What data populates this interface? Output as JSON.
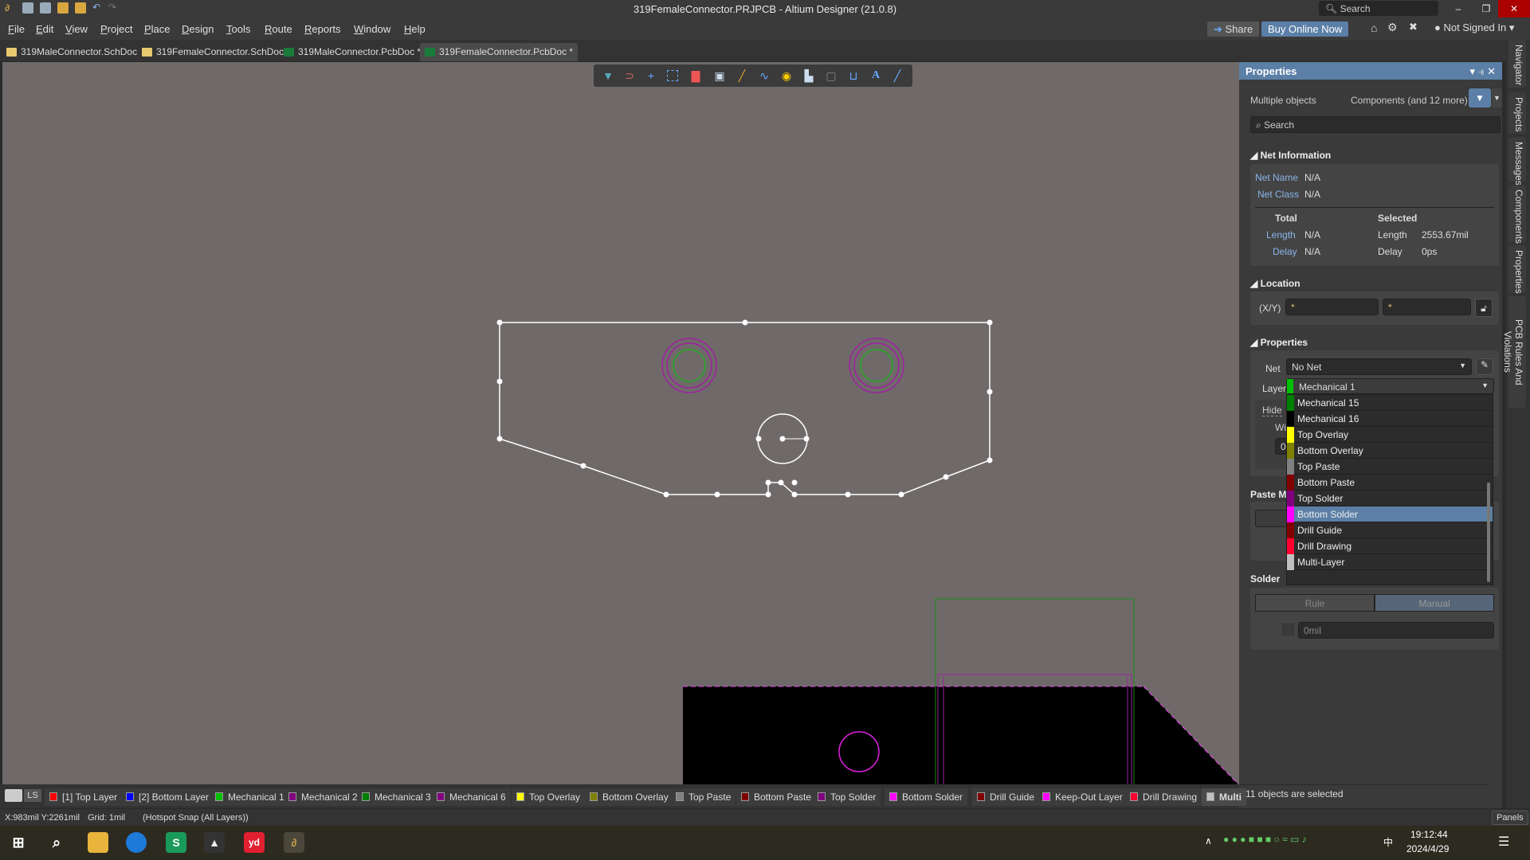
{
  "window": {
    "title": "319FemaleConnector.PRJPCB - Altium Designer (21.0.8)",
    "search_placeholder": "Search"
  },
  "menu": [
    "File",
    "Edit",
    "View",
    "Project",
    "Place",
    "Design",
    "Tools",
    "Route",
    "Reports",
    "Window",
    "Help"
  ],
  "header_buttons": {
    "share": "Share",
    "buy": "Buy Online Now",
    "account": "Not Signed In"
  },
  "tabs": [
    {
      "label": "319MaleConnector.SchDoc",
      "type": "sch"
    },
    {
      "label": "319FemaleConnector.SchDoc",
      "type": "sch"
    },
    {
      "label": "319MaleConnector.PcbDoc *",
      "type": "pcb"
    },
    {
      "label": "319FemaleConnector.PcbDoc *",
      "type": "pcb",
      "active": true
    }
  ],
  "toolbar_icons": [
    "filter-icon",
    "interactive-routing-icon",
    "crosshair-icon",
    "select-rect-icon",
    "align-icon",
    "component-icon",
    "route-icon",
    "length-tune-icon",
    "via-icon",
    "polygon-icon",
    "keepout-icon",
    "dimension-icon",
    "text-icon",
    "line-icon"
  ],
  "panel": {
    "title": "Properties",
    "selection": "Multiple objects",
    "filter": "Components (and 12 more)",
    "search_placeholder": "Search",
    "net_info": {
      "title": "Net Information",
      "net_name_label": "Net Name",
      "net_name": "N/A",
      "net_class_label": "Net Class",
      "net_class": "N/A",
      "total": "Total",
      "selected": "Selected",
      "length_label": "Length",
      "total_length": "N/A",
      "sel_length": "2553.67mil",
      "delay_label": "Delay",
      "total_delay": "N/A",
      "sel_delay": "0ps"
    },
    "location": {
      "title": "Location",
      "label": "(X/Y)",
      "x": "*",
      "y": "*"
    },
    "properties": {
      "title": "Properties",
      "net_label": "Net",
      "net": "No Net",
      "layer_label": "Layer",
      "layer": "Mechanical 1",
      "layer_color": "#00c000",
      "hide": "Hide",
      "width_label": "Wi",
      "width_val": "0"
    },
    "paste": {
      "title": "Paste M"
    },
    "solder": {
      "title": "Solder",
      "rule": "Rule",
      "manual": "Manual",
      "value": "0mil"
    },
    "layer_options": [
      {
        "label": "Mechanical 15",
        "color": "#008000"
      },
      {
        "label": "Mechanical 16",
        "color": "#000000"
      },
      {
        "label": "Top Overlay",
        "color": "#ffff00"
      },
      {
        "label": "Bottom Overlay",
        "color": "#808000"
      },
      {
        "label": "Top Paste",
        "color": "#808080"
      },
      {
        "label": "Bottom Paste",
        "color": "#800000"
      },
      {
        "label": "Top Solder",
        "color": "#800080"
      },
      {
        "label": "Bottom Solder",
        "color": "#ff00ff",
        "selected": true
      },
      {
        "label": "Drill Guide",
        "color": "#800000"
      },
      {
        "label": "Drill Drawing",
        "color": "#ff0030"
      },
      {
        "label": "Multi-Layer",
        "color": "#c0c0c0"
      }
    ],
    "footer": "11 objects are selected"
  },
  "right_tabs": [
    "Navigator",
    "Projects",
    "Messages",
    "Components",
    "Properties",
    "PCB Rules And Violations"
  ],
  "layers": [
    {
      "label": "[1] Top Layer",
      "color": "#ff0000"
    },
    {
      "label": "[2] Bottom Layer",
      "color": "#0000ff"
    },
    {
      "label": "Mechanical 1",
      "color": "#00c000"
    },
    {
      "label": "Mechanical 2",
      "color": "#800080"
    },
    {
      "label": "Mechanical 3",
      "color": "#008000"
    },
    {
      "label": "Mechanical 6",
      "color": "#800080"
    },
    {
      "label": "Top Overlay",
      "color": "#ffff00"
    },
    {
      "label": "Bottom Overlay",
      "color": "#808000"
    },
    {
      "label": "Top Paste",
      "color": "#808080"
    },
    {
      "label": "Bottom Paste",
      "color": "#800000"
    },
    {
      "label": "Top Solder",
      "color": "#800080"
    },
    {
      "label": "Bottom Solder",
      "color": "#ff00ff"
    },
    {
      "label": "Drill Guide",
      "color": "#800000"
    },
    {
      "label": "Keep-Out Layer",
      "color": "#ff00ff"
    },
    {
      "label": "Drill Drawing",
      "color": "#ff0030"
    },
    {
      "label": "Multi",
      "color": "#c0c0c0"
    }
  ],
  "layer_set": "LS",
  "status": {
    "coords": "X:983mil Y:2261mil",
    "grid": "Grid: 1mil",
    "snap": "(Hotspot Snap (All Layers))",
    "panels": "Panels"
  },
  "taskbar": {
    "time": "19:12:44",
    "date": "2024/4/29",
    "ime": "中",
    "apps": [
      "windows-start-icon",
      "search-icon",
      "file-explorer-icon",
      "edge-icon",
      "wps-icon",
      "inkscape-icon",
      "youdao-icon",
      "altium-icon"
    ]
  }
}
